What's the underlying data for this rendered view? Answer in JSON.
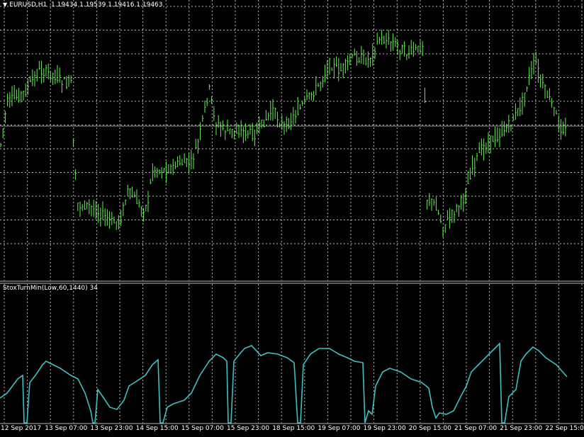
{
  "header": {
    "symbol": "EURUSD,H1",
    "open": "1.19434",
    "high": "1.19539",
    "low": "1.19416",
    "close": "1.19463"
  },
  "indicator": {
    "label": "StoxTurnMin(Low,60,1440) 34"
  },
  "colors": {
    "background": "#000000",
    "candle": "#66ee55",
    "indicator": "#3fc0c0",
    "grid": "#bcbcbc",
    "text": "#ffffff"
  },
  "time_axis": [
    "12 Sep 2017",
    "13 Sep 07:00",
    "13 Sep 23:00",
    "14 Sep 15:00",
    "15 Sep 07:00",
    "15 Sep 23:00",
    "18 Sep 15:00",
    "19 Sep 07:00",
    "19 Sep 23:00",
    "20 Sep 15:00",
    "21 Sep 07:00",
    "21 Sep 23:00",
    "22 Sep 15:00"
  ],
  "chart_data": [
    {
      "type": "candlestick",
      "symbol": "EURUSD",
      "timeframe": "H1",
      "x": [
        "12 Sep 2017",
        "13 Sep 07:00",
        "13 Sep 23:00",
        "14 Sep 15:00",
        "15 Sep 07:00",
        "15 Sep 23:00",
        "18 Sep 15:00",
        "19 Sep 07:00",
        "19 Sep 23:00",
        "20 Sep 15:00",
        "21 Sep 07:00",
        "21 Sep 23:00",
        "22 Sep 15:00"
      ],
      "close_trend": [
        0.62,
        0.78,
        0.12,
        0.2,
        0.55,
        0.42,
        0.58,
        0.82,
        0.9,
        0.1,
        0.48,
        0.88,
        0.5
      ],
      "note_last_ohlc": {
        "open": 1.19434,
        "high": 1.19539,
        "low": 1.19416,
        "close": 1.19463
      }
    },
    {
      "type": "line",
      "series": [
        {
          "name": "StoxTurnMin(Low,60,1440)",
          "last_value": 34
        }
      ]
    }
  ]
}
